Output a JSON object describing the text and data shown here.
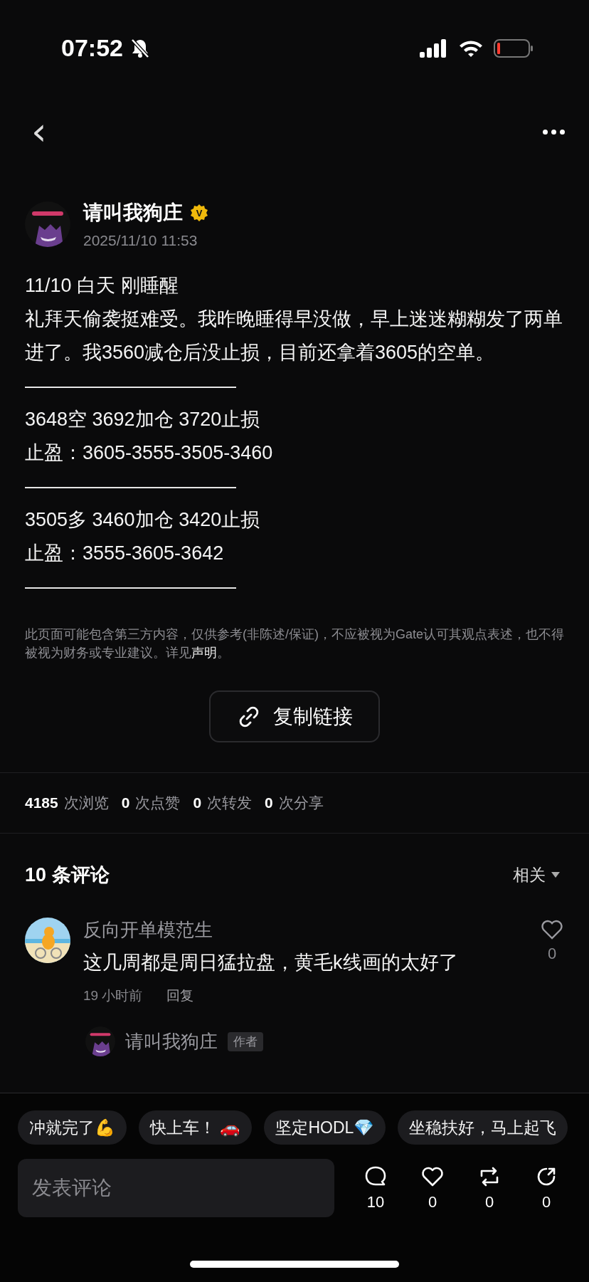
{
  "status_bar": {
    "time": "07:52",
    "muted": true
  },
  "nav": {
    "back": "‹"
  },
  "author": {
    "name": "请叫我狗庄",
    "verified": true,
    "verified_mark": "V",
    "date": "2025/11/10 11:53"
  },
  "post": {
    "lines": [
      "11/10 白天  刚睡醒",
      "礼拜天偷袭挺难受。我昨晚睡得早没做，早上迷迷糊糊发了两单进了。我3560减仓后没止损，目前还拿着3605的空单。",
      "———————————",
      "3648空 3692加仓 3720止损",
      "止盈：3605-3555-3505-3460",
      "———————————",
      "3505多 3460加仓  3420止损",
      "止盈：3555-3605-3642",
      "———————————"
    ]
  },
  "disclaimer": {
    "text": "此页面可能包含第三方内容，仅供参考(非陈述/保证)，不应被视为Gate认可其观点表述，也不得被视为财务或专业建议。详见",
    "link": "声明",
    "end": "。"
  },
  "copy_link": "复制链接",
  "stats": [
    {
      "count": "4185",
      "label": "次浏览"
    },
    {
      "count": "0",
      "label": "次点赞"
    },
    {
      "count": "0",
      "label": "次转发"
    },
    {
      "count": "0",
      "label": "次分享"
    }
  ],
  "comments": {
    "title": "10 条评论",
    "sort": "相关",
    "items": [
      {
        "name": "反向开单模范生",
        "text": "这几周都是周日猛拉盘，黄毛k线画的太好了",
        "time": "19 小时前",
        "reply": "回复",
        "likes": "0",
        "liked": false
      }
    ],
    "reply_preview": {
      "name": "请叫我狗庄",
      "badge": "作者"
    }
  },
  "quick_replies": [
    "冲就完了💪",
    "快上车！ 🚗",
    "坚定HODL💎",
    "坐稳扶好，马上起飞"
  ],
  "composer": {
    "placeholder": "发表评论"
  },
  "actions": [
    {
      "kind": "comment",
      "count": "10"
    },
    {
      "kind": "like",
      "count": "0"
    },
    {
      "kind": "repost",
      "count": "0"
    },
    {
      "kind": "share",
      "count": "0"
    }
  ]
}
